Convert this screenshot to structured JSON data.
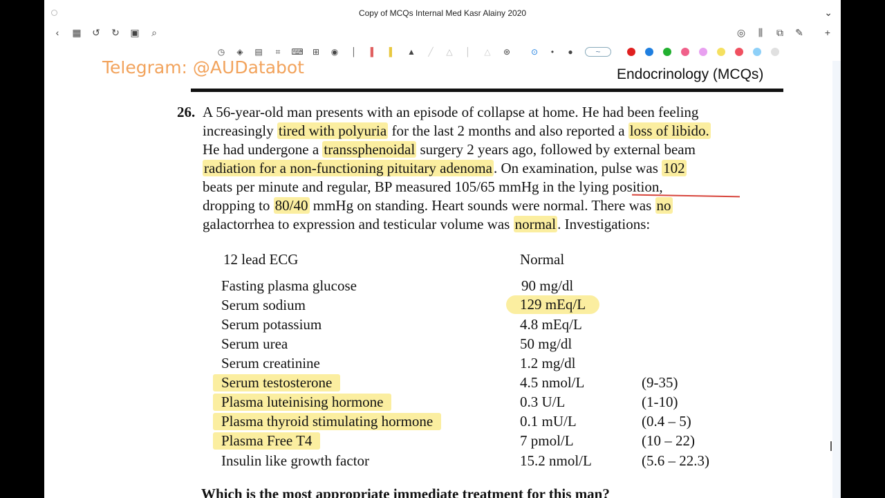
{
  "window": {
    "title": "Copy of MCQs Internal Med Kasr Alainy 2020"
  },
  "nav_icons": [
    "back-icon",
    "grid-icon",
    "undo-icon",
    "redo-icon",
    "page-icon",
    "search-icon"
  ],
  "top_right_icons": [
    "globe-icon",
    "reader-icon",
    "cast-icon",
    "edit-icon",
    "plus-icon"
  ],
  "tool_icons": [
    "timer-icon",
    "shapes-icon",
    "layers-icon",
    "crop-icon",
    "keyboard-icon",
    "book-icon",
    "eraser-icon",
    "pen-blue-icon",
    "highlighter-red-icon",
    "highlighter-yellow-icon",
    "pen-black-icon",
    "pencil-icon",
    "pen-grey-icon",
    "marker-icon",
    "pen-light-icon",
    "lasso-icon"
  ],
  "swatches": [
    "#e02020",
    "#1f7fe0",
    "#22b030",
    "#f0608a",
    "#e8a0f0",
    "#f5e060",
    "#f05060",
    "#8ed0f8",
    "#e0e0e0"
  ],
  "doc": {
    "watermark": "Telegram: @AUDatabot",
    "chapter": "Endocrinology (MCQs)",
    "question_number": "26.",
    "lines": [
      [
        "A 56-year-old man presents with an episode of collapse at home. He had been feeling"
      ],
      [
        "increasingly ",
        "tired with polyuria",
        " for the last 2 months and also reported a ",
        "loss of libido."
      ],
      [
        "He had undergone a ",
        "transsphenoidal",
        " surgery 2 years ago, followed by external beam"
      ],
      [
        "radiation for a non-functioning pituitary adenoma",
        ". On examination, pulse was ",
        "102"
      ],
      [
        "beats per minute and regular, BP measured 105/65 mmHg in the lying position,"
      ],
      [
        "dropping to ",
        "80/40",
        " mmHg on standing. Heart sounds were normal. There was ",
        "no"
      ],
      [
        "galactorrhea to expression and testicular volume was ",
        "normal",
        ". Investigations:"
      ]
    ],
    "investigations": [
      {
        "test": "12 lead ECG",
        "value": "Normal",
        "range": ""
      },
      {
        "test": "Fasting plasma glucose",
        "value": "90 mg/dl",
        "range": ""
      },
      {
        "test": "Serum sodium",
        "value": "129 mEq/L",
        "range": ""
      },
      {
        "test": "Serum potassium",
        "value": "4.8 mEq/L",
        "range": ""
      },
      {
        "test": "Serum urea",
        "value": "50 mg/dl",
        "range": ""
      },
      {
        "test": "Serum creatinine",
        "value": "1.2 mg/dl",
        "range": ""
      },
      {
        "test": "Serum testosterone",
        "value": "4.5 nmol/L",
        "range": "(9-35)"
      },
      {
        "test": "Plasma luteinising hormone",
        "value": "0.3 U/L",
        "range": "(1-10)"
      },
      {
        "test": "Plasma thyroid stimulating hormone",
        "value": "0.1 mU/L",
        "range": "(0.4 – 5)"
      },
      {
        "test": "Plasma Free T4",
        "value": "7 pmol/L",
        "range": "(10 – 22)"
      },
      {
        "test": "Insulin like growth factor",
        "value": "15.2 nmol/L",
        "range": "(5.6 – 22.3)"
      }
    ],
    "question": "Which is the most appropriate immediate treatment for this man?"
  }
}
